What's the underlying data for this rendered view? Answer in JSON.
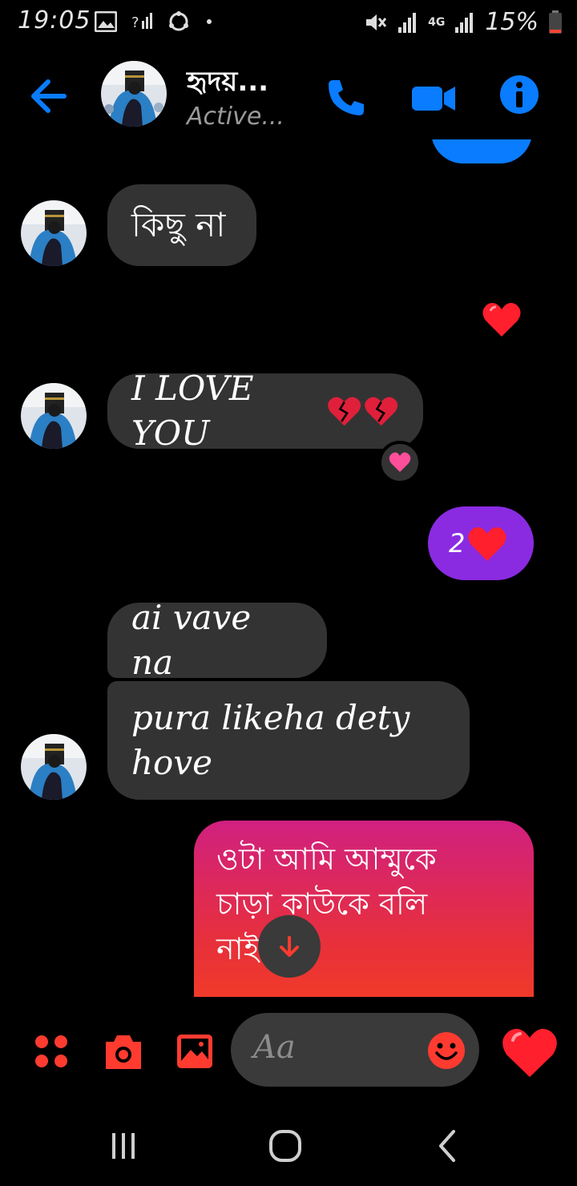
{
  "status_bar": {
    "time": "19:05",
    "battery": "15%",
    "network": "4G"
  },
  "header": {
    "contact_name": "হৃদয়...",
    "contact_status": "Active...",
    "accent_color": "#0a7cff"
  },
  "messages": [
    {
      "direction": "incoming",
      "text": "কিছু না"
    },
    {
      "direction": "outgoing",
      "type": "emoji",
      "icon": "heart"
    },
    {
      "direction": "incoming",
      "text": "I LOVE YOU",
      "emoji": "broken-heart x2",
      "reaction": "pink-heart"
    },
    {
      "direction": "outgoing",
      "text": "2",
      "emoji": "heart",
      "color": "#8a2be2"
    },
    {
      "direction": "incoming",
      "text": "ai vave na"
    },
    {
      "direction": "incoming",
      "text_line1": "pura likeha dety",
      "text_line2": "hove"
    },
    {
      "direction": "outgoing",
      "text_line1": "ওটা আমি আম্মুকে",
      "text_line2": "চাড়া কাউকে বলি",
      "text_line3": "নাই"
    }
  ],
  "composer": {
    "placeholder": "Aa",
    "accent_color": "#ff3b30"
  }
}
